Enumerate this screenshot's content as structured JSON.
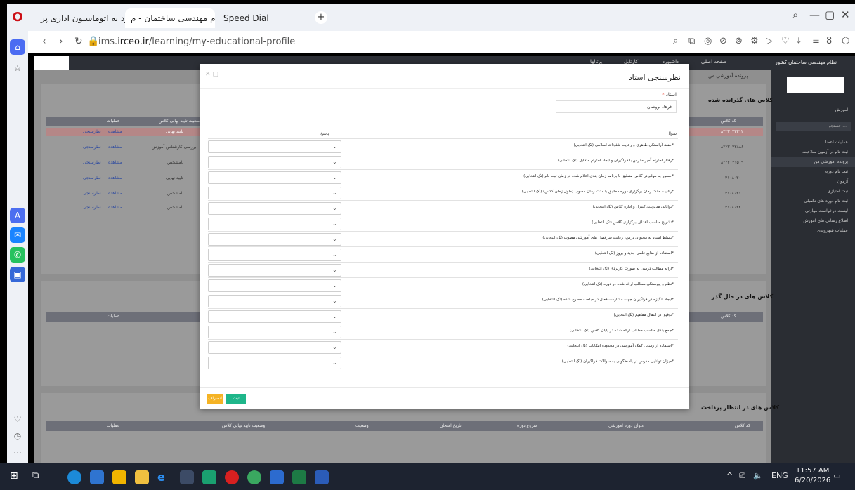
{
  "browser": {
    "tabs": [
      {
        "label": "ورود به اتوماسیون اداری پر..."
      },
      {
        "label": "نظام مهندسی ساختمان - م..."
      },
      {
        "label": "Speed Dial"
      }
    ],
    "url_prefix": "ims.",
    "url_domain": "irceo.ir",
    "url_path": "/learning/my-educational-profile"
  },
  "topnav": {
    "items": [
      "صفحه اصلی",
      "داشبورد",
      "کارتابل",
      "پرتالها"
    ]
  },
  "rightnav": {
    "header": "نظام مهندسی ساختمان کشور",
    "section": "آموزش",
    "search_placeholder": "جستجو ...",
    "items": [
      "عملیات اعضا",
      "ثبت نام در آزمون صلاحیت",
      "پرونده آموزشی من",
      "ثبت نام دوره",
      "آزمون",
      "ثبت امتیازی",
      "ثبت نام دوره های تکمیلی",
      "لیست درخواست مهارتی",
      "اطلاع رسانی های آموزش",
      "عملیات شهروندی"
    ]
  },
  "breadcrumb": "پرونده آموزشی من",
  "sections": {
    "passed": "کلاس های گذرانده شده",
    "in_progress": "کلاس های در حال گذر",
    "awaiting_payment": "کلاس های در انتظار پرداخت"
  },
  "bg_table": {
    "headers": [
      "کد کلاس",
      "وضعیت تایید نهایی کلاس",
      "عملیات"
    ],
    "rows": [
      {
        "code": "۸۲۲۲۰۳۲۲۱۲",
        "status": "تایید نهایی",
        "action1": "مشاهده",
        "action2": "نظرسنجی"
      },
      {
        "code": "۸۲۲۲۰۳۲۸۸۶",
        "status": "بررسی کارشناس آموزش",
        "action1": "مشاهده",
        "action2": "نظرسنجی"
      },
      {
        "code": "۸۲۲۲۰۳۱۵۰۹",
        "status": "نامشخص",
        "action1": "مشاهده",
        "action2": "نظرسنجی"
      },
      {
        "code": "۳۱۰۸۰۳۰",
        "status": "تایید نهایی",
        "action1": "مشاهده",
        "action2": "نظرسنجی"
      },
      {
        "code": "۳۱۰۸۰۳۱",
        "status": "نامشخص",
        "action1": "مشاهده",
        "action2": "نظرسنجی"
      },
      {
        "code": "۳۱۰۸۰۳۲",
        "status": "نامشخص",
        "action1": "مشاهده",
        "action2": "نظرسنجی"
      }
    ],
    "payment_headers": [
      "کد کلاس",
      "عنوان دوره آموزشی",
      "شروع دوره",
      "تاریخ امتحان",
      "وضعیت",
      "وضعیت تایید نهایی کلاس",
      "عملیات"
    ]
  },
  "modal": {
    "title": "نظرسنجی استاد",
    "teacher_label": "استاد",
    "teacher_value": "فرهاد بروشان",
    "question_header": "سوال",
    "answer_header": "پاسخ",
    "questions": [
      "حفظ آراستگی ظاهری و رعایت شئونات اسلامی (تک انتخابی)*",
      "رفتار احترام آمیز مدرس با فراگیران و ایجاد احترام متقابل (تک انتخابی)*",
      "حضور به موقع در کلاس منطبق با برنامه زمان بندی اعلام شده در زمان ثبت نام (تک انتخابی)*",
      "رعایت مدت زمان برگزاری دوره مطابق با مدت زمان مصوب (طول زمان کلاس) (تک انتخابی)*",
      "توانایی مدیریت، کنترل و اداره کلاس (تک انتخابی)*",
      "تشریح مناسب اهداف برگزاری کلاس (تک انتخابی)*",
      "تسلط استاد به محتوای درس، رعایت سرفصل های آموزشی مصوب (تک انتخابی)*",
      "استفاده از منابع علمی جدید و بروز (تک انتخابی)*",
      "ارائه مطالب درسی به صورت کاربردی (تک انتخابی)*",
      "نظم و پیوستگی مطالب ارائه شده در دوره (تک انتخابی)*",
      "ایجاد انگیزه در فراگیران جهت مشارکت فعال در مباحث مطرح شده (تک انتخابی)*",
      "توفیق در انتقال مفاهیم (تک انتخابی)*",
      "جمع بندی مناسب مطالب ارائه شده در پایان کلاس (تک انتخابی)*",
      "استفاده از وسایل کمک آموزشی در محدوده امکانات (تک انتخابی)*",
      "میزان توانایی مدرس در پاسخگویی به سوالات فراگیران (تک انتخابی)*"
    ],
    "submit_label": "ثبت",
    "cancel_label": "انصراف"
  },
  "taskbar": {
    "lang": "ENG",
    "time": "11:57 AM",
    "date": "6/20/2026"
  },
  "colors": {
    "submit": "#1fb68a",
    "cancel": "#f5b324",
    "highlight_row": "#c49090",
    "opera_red": "#cc0f16"
  }
}
